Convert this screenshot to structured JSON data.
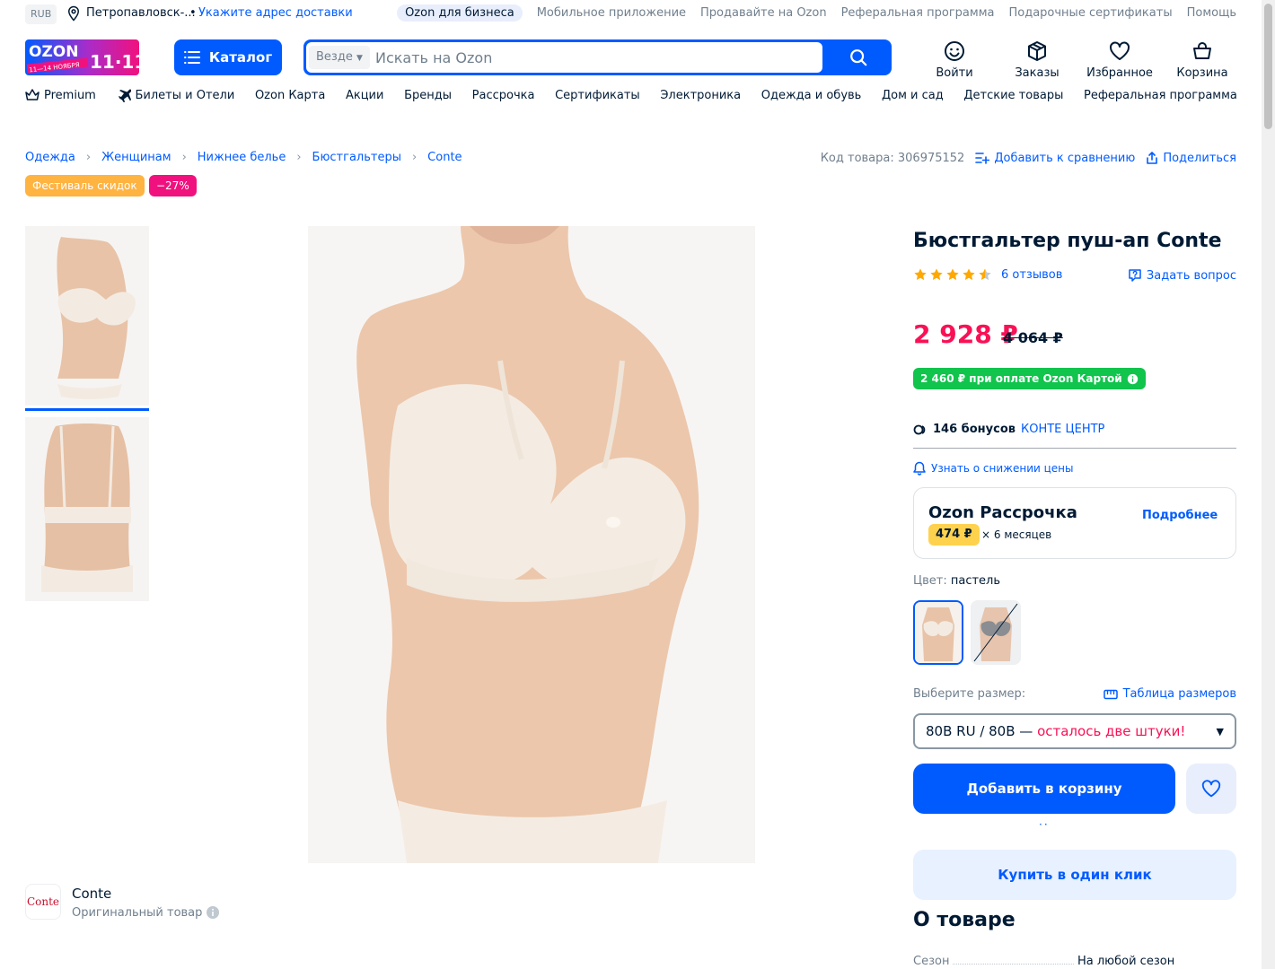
{
  "topbar": {
    "currency": "RUB",
    "city": "Петропавловск-...",
    "separator": "•",
    "address_link": "Укажите адрес доставки",
    "links": [
      "Ozon для бизнеса",
      "Мобильное приложение",
      "Продавайте на Ozon",
      "Реферальная программа",
      "Подарочные сертификаты",
      "Помощь"
    ]
  },
  "header": {
    "logo_text": "OZON",
    "logo_promo": "11·11",
    "logo_dates": "11—14 НОЯБРЯ",
    "catalog_label": "Каталог",
    "search_scope": "Везде",
    "search_placeholder": "Искать на Ozon",
    "icons": {
      "login": "Войти",
      "orders": "Заказы",
      "favorites": "Избранное",
      "cart": "Корзина"
    }
  },
  "nav": [
    "Premium",
    "Билеты и Отели",
    "Ozon Карта",
    "Акции",
    "Бренды",
    "Рассрочка",
    "Сертификаты",
    "Электроника",
    "Одежда и обувь",
    "Дом и сад",
    "Детские товары",
    "Реферальная программа"
  ],
  "breadcrumbs": [
    "Одежда",
    "Женщинам",
    "Нижнее белье",
    "Бюстгальтеры",
    "Conte"
  ],
  "product_meta": {
    "code": "Код товара: 306975152",
    "compare": "Добавить к сравнению",
    "share": "Поделиться"
  },
  "badges": {
    "festival": "Фестиваль скидок",
    "discount": "−27%"
  },
  "brand": {
    "logo_text": "Conte",
    "name": "Conte",
    "original": "Оригинальный товар"
  },
  "product": {
    "title": "Бюстгальтер пуш-ап Conte",
    "rating": 4.5,
    "reviews": "6 отзывов",
    "ask": "Задать вопрос",
    "price": "2 928 ₽",
    "old_price": "4 064 ₽",
    "card_price": "2 460 ₽ при оплате Ozon Картой",
    "bonus_count": "146 бонусов",
    "bonus_store": "КОНТЕ ЦЕНТР",
    "notify": "Узнать о снижении цены",
    "installment": {
      "title": "Ozon Рассрочка",
      "amount": "474 ₽",
      "months": "× 6 месяцев",
      "more": "Подробнее"
    },
    "color_label": "Цвет:",
    "color_value": "пастель",
    "size_label": "Выберите размер:",
    "size_table": "Таблица размеров",
    "size_selected": "80B RU / 80B —",
    "size_warning": "осталось две штуки!",
    "add_to_cart": "Добавить в корзину",
    "dots": "··",
    "one_click": "Купить в один клик",
    "about_title": "О товаре",
    "spec_key": "Сезон",
    "spec_value": "На любой сезон"
  },
  "colors": {
    "accent": "#005bff",
    "price": "#f91155",
    "card_green": "#10c44c",
    "festival": "#ffb340",
    "discount": "#f1117e",
    "star": "#ffa800"
  }
}
